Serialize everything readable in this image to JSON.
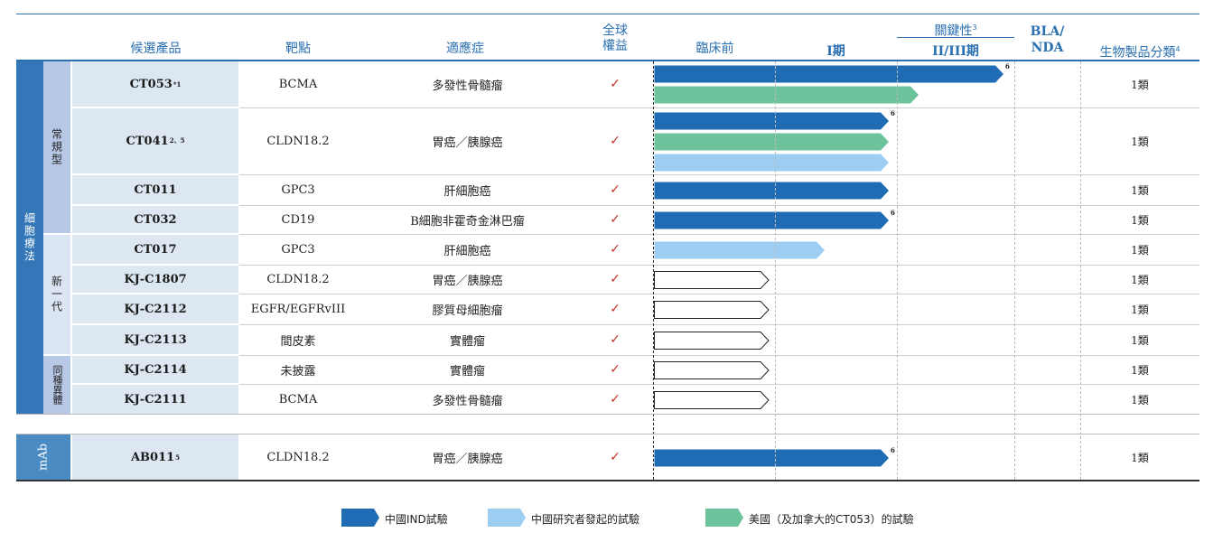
{
  "colors": {
    "china_ind": "#1f6cb5",
    "iit": "#9dcdf0",
    "us": "#6cc39c",
    "header": "#2a6fb0",
    "check": "#c0392b"
  },
  "headers": {
    "product": "候選產品",
    "target": "靶點",
    "indication": "適應症",
    "rights_line1": "全球",
    "rights_line2": "權益",
    "preclinical": "臨床前",
    "phase1": "I期",
    "pivotal_line1": "關鍵性",
    "pivotal_sup": "3",
    "pivotal_line2": "II/III期",
    "bla_line1": "BLA/",
    "bla_line2": "NDA",
    "bio_class": "生物製品分類",
    "bio_class_sup": "4"
  },
  "groups": {
    "cell_therapy": "細胞療法",
    "conventional": "常規型",
    "next_gen": "新一代",
    "allogeneic": "同種異體",
    "mab": "mAb"
  },
  "rows": [
    {
      "product": "CT053",
      "sup": "*1",
      "target": "BCMA",
      "indication": "多發性骨髓瘤",
      "rights": "✓",
      "class": "1類",
      "bars": [
        {
          "type": "china_ind",
          "end": 0.82,
          "footnote": "6"
        },
        {
          "type": "us",
          "end": 0.62,
          "footnote": ""
        }
      ]
    },
    {
      "product": "CT041",
      "sup": "2、5",
      "target": "CLDN18.2",
      "indication": "胃癌／胰腺癌",
      "rights": "✓",
      "class": "1類",
      "bars": [
        {
          "type": "china_ind",
          "end": 0.55,
          "footnote": "6"
        },
        {
          "type": "us",
          "end": 0.55,
          "footnote": ""
        },
        {
          "type": "iit",
          "end": 0.55,
          "footnote": ""
        }
      ]
    },
    {
      "product": "CT011",
      "sup": "",
      "target": "GPC3",
      "indication": "肝細胞癌",
      "rights": "✓",
      "class": "1類",
      "bars": [
        {
          "type": "china_ind",
          "end": 0.55,
          "footnote": ""
        }
      ]
    },
    {
      "product": "CT032",
      "sup": "",
      "target": "CD19",
      "indication": "B細胞非霍奇金淋巴瘤",
      "rights": "✓",
      "class": "1類",
      "bars": [
        {
          "type": "china_ind",
          "end": 0.55,
          "footnote": "6"
        }
      ]
    },
    {
      "product": "CT017",
      "sup": "",
      "target": "GPC3",
      "indication": "肝細胞癌",
      "rights": "✓",
      "class": "1類",
      "bars": [
        {
          "type": "iit",
          "end": 0.4,
          "footnote": ""
        }
      ]
    },
    {
      "product": "KJ-C1807",
      "sup": "",
      "target": "CLDN18.2",
      "indication": "胃癌／胰腺癌",
      "rights": "✓",
      "class": "1類",
      "bars": [
        {
          "type": "preclinical",
          "end": 0.27,
          "footnote": ""
        }
      ]
    },
    {
      "product": "KJ-C2112",
      "sup": "",
      "target": "EGFR/EGFRvIII",
      "indication": "膠質母細胞瘤",
      "rights": "✓",
      "class": "1類",
      "bars": [
        {
          "type": "preclinical",
          "end": 0.27,
          "footnote": ""
        }
      ]
    },
    {
      "product": "KJ-C2113",
      "sup": "",
      "target": "間皮素",
      "indication": "實體瘤",
      "rights": "✓",
      "class": "1類",
      "bars": [
        {
          "type": "preclinical",
          "end": 0.27,
          "footnote": ""
        }
      ]
    },
    {
      "product": "KJ-C2114",
      "sup": "",
      "target": "未披露",
      "indication": "實體瘤",
      "rights": "✓",
      "class": "1類",
      "bars": [
        {
          "type": "preclinical",
          "end": 0.27,
          "footnote": ""
        }
      ]
    },
    {
      "product": "KJ-C2111",
      "sup": "",
      "target": "BCMA",
      "indication": "多發性骨髓瘤",
      "rights": "✓",
      "class": "1類",
      "bars": [
        {
          "type": "preclinical",
          "end": 0.27,
          "footnote": ""
        }
      ]
    },
    {
      "product": "AB011",
      "sup": "5",
      "target": "CLDN18.2",
      "indication": "胃癌／胰腺癌",
      "rights": "✓",
      "class": "1類",
      "bars": [
        {
          "type": "china_ind",
          "end": 0.55,
          "footnote": "6"
        }
      ]
    }
  ],
  "legend": [
    {
      "type": "china_ind",
      "label": "中國IND試驗"
    },
    {
      "type": "iit",
      "label": "中國研究者發起的試驗"
    },
    {
      "type": "us",
      "label": "美國（及加拿大的CT053）的試驗"
    }
  ]
}
